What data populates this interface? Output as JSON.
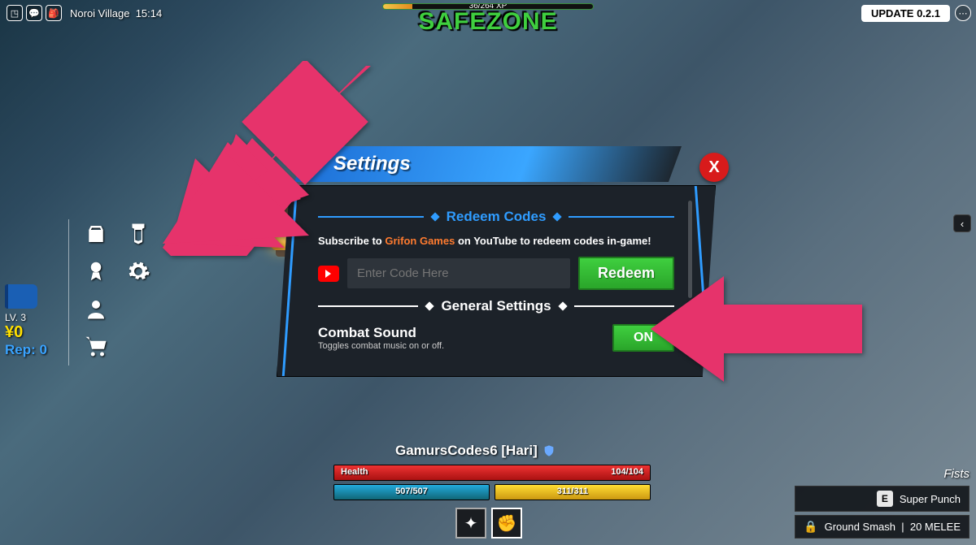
{
  "top": {
    "location": "Noroi Village",
    "time": "15:14",
    "update_badge": "UPDATE 0.2.1"
  },
  "xp": {
    "text": "36/264 XP",
    "safezone": "SAFEZONE"
  },
  "stats": {
    "level": "LV. 3",
    "yen": "¥0",
    "rep": "Rep: 0"
  },
  "modal": {
    "title": "Settings",
    "close": "X",
    "redeem_section": "Redeem Codes",
    "subscribe_pre": "Subscribe to ",
    "subscribe_name": "Grifon Games",
    "subscribe_post": " on YouTube to redeem codes in-game!",
    "code_placeholder": "Enter Code Here",
    "redeem_btn": "Redeem",
    "general_section": "General Settings",
    "combat_label": "Combat Sound",
    "combat_desc": "Toggles combat music on or off.",
    "combat_state": "ON"
  },
  "player": {
    "name": "GamursCodes6 [Hari]",
    "health_label": "Health",
    "health_val": "104/104",
    "mana_val": "507/507",
    "stam_val": "311/311"
  },
  "abilities": {
    "weapon": "Fists",
    "a1_key": "E",
    "a1_name": "Super Punch",
    "a2_name": "Ground Smash",
    "a2_cost": "20 MELEE"
  }
}
